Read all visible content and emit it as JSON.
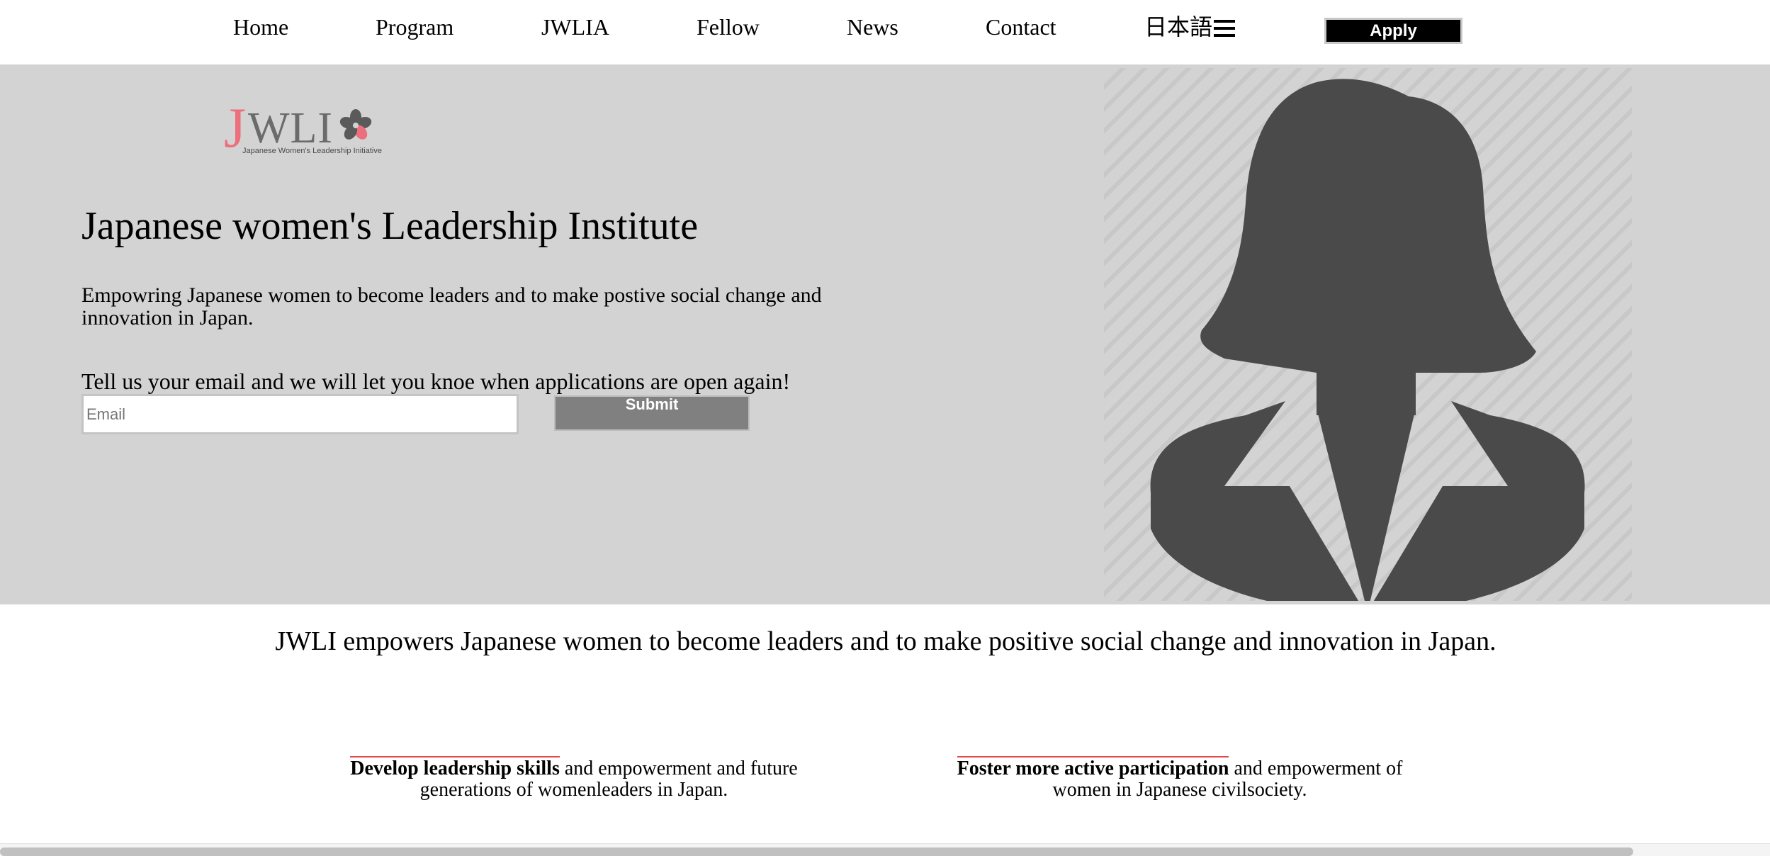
{
  "nav": {
    "items": [
      {
        "label": "Home"
      },
      {
        "label": "Program"
      },
      {
        "label": "JWLIA"
      },
      {
        "label": "Fellow"
      },
      {
        "label": "News"
      },
      {
        "label": "Contact"
      },
      {
        "label": "日本語"
      }
    ],
    "apply_label": "Apply",
    "menu_icon": "hamburger-icon"
  },
  "hero": {
    "logo": {
      "letter_j": "J",
      "letters_wli": "WLI",
      "tagline": "Japanese Women's Leadership Initiative",
      "flower_icon": "cherry-blossom-icon"
    },
    "title": "Japanese women's Leadership Institute",
    "subtitle": "Empowring Japanese women to become leaders and to make postive social change and innovation in Japan.",
    "cta": "Tell us your email and we will let you knoe when applications are open again!",
    "email_placeholder": "Email",
    "email_value": "",
    "submit_label": "Submit",
    "portrait_icon": "woman-silhouette-icon"
  },
  "mission": "JWLI empowers Japanese women to become leaders and to make positive social change and innovation in Japan.",
  "pillars": [
    {
      "bold": "Develop leadership skills",
      "text": " and empowerment and future generations of womenleaders in Japan."
    },
    {
      "bold": "Foster more active participation",
      "text": " and empowerment of women in Japanese civilsociety."
    }
  ],
  "colors": {
    "hero_bg": "#d3d3d3",
    "silhouette": "#4a4a4a",
    "logo_pink": "#ec6f7d",
    "logo_gray": "#6b6b6b",
    "apply_bg": "#000000",
    "submit_bg": "#808080",
    "underline_red": "#e5484d"
  }
}
